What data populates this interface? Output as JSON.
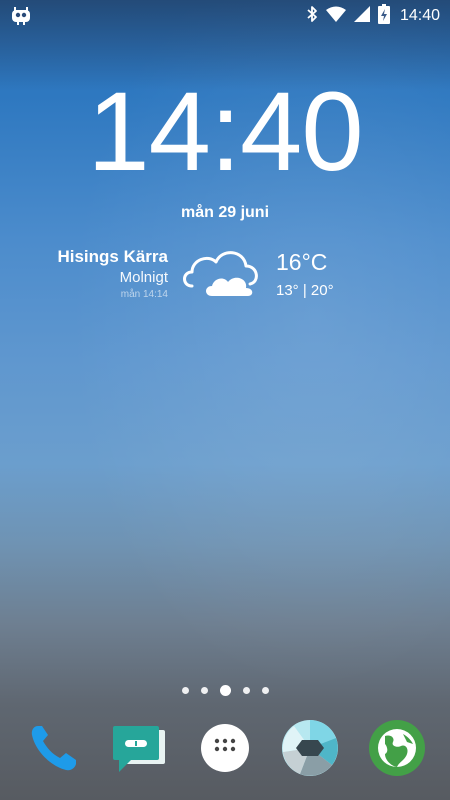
{
  "status_bar": {
    "time": "14:40",
    "left_icons": [
      "cyanogenmod-icon"
    ],
    "right_icons": [
      "bluetooth-icon",
      "wifi-icon",
      "cell-signal-icon",
      "battery-charging-icon"
    ]
  },
  "lockscreen": {
    "clock": "14:40",
    "date": "mån 29 juni"
  },
  "weather": {
    "city": "Hisings Kärra",
    "condition": "Molnigt",
    "updated": "mån 14:14",
    "temperature": "16°C",
    "range": "13° | 20°",
    "icon": "cloudy-icon"
  },
  "home_pages": {
    "count": 5,
    "active_index": 2
  },
  "dock": {
    "apps": [
      {
        "name": "Phone",
        "icon": "phone-icon",
        "color": "#1e9be9"
      },
      {
        "name": "Messaging",
        "icon": "messaging-icon",
        "color": "#26a69a"
      },
      {
        "name": "App drawer",
        "icon": "app-drawer-icon",
        "color": "#ffffff"
      },
      {
        "name": "Camera",
        "icon": "camera-shutter-icon",
        "color": "#80deea"
      },
      {
        "name": "Browser",
        "icon": "browser-globe-icon",
        "color": "#43a047"
      }
    ]
  },
  "colors": {
    "wallpaper_top": "#2a6fb6",
    "wallpaper_bottom": "#575b61",
    "text": "#ffffff"
  }
}
